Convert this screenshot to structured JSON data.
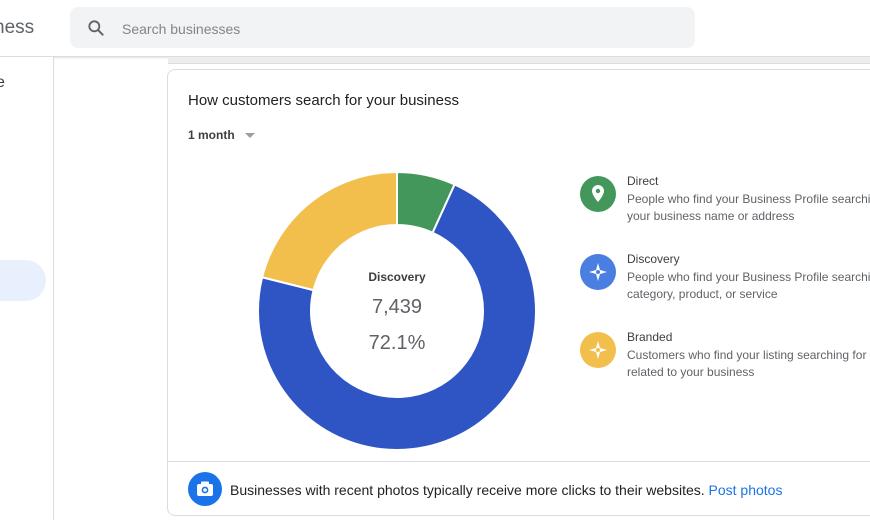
{
  "header": {
    "brand_fragment": "ness",
    "search_placeholder": "Search businesses"
  },
  "sidebar": {
    "fragment_text": "e"
  },
  "card": {
    "title": "How customers search for your business",
    "period": "1 month"
  },
  "center": {
    "name": "Discovery",
    "value": "7,439",
    "percent": "72.1%"
  },
  "chart_data": {
    "type": "pie",
    "categories": [
      "Direct",
      "Discovery",
      "Branded"
    ],
    "values": [
      6.8,
      72.1,
      21.1
    ],
    "colors": [
      "#43975a",
      "#2f55c4",
      "#f2bf4c"
    ]
  },
  "legend": [
    {
      "title": "Direct",
      "desc": "People who find your Business Profile searching for your business name or address",
      "color": "#43975a",
      "icon": "pin-icon"
    },
    {
      "title": "Discovery",
      "desc": "People who find your Business Profile searching for a category, product, or service",
      "color": "#4a7ee0",
      "icon": "compass-icon"
    },
    {
      "title": "Branded",
      "desc": "Customers who find your listing searching for a brand related to your business",
      "color": "#f2bf4c",
      "icon": "star-badge-icon"
    }
  ],
  "footer": {
    "message": "Businesses with recent photos typically receive more clicks to their websites.",
    "link": "Post photos"
  }
}
